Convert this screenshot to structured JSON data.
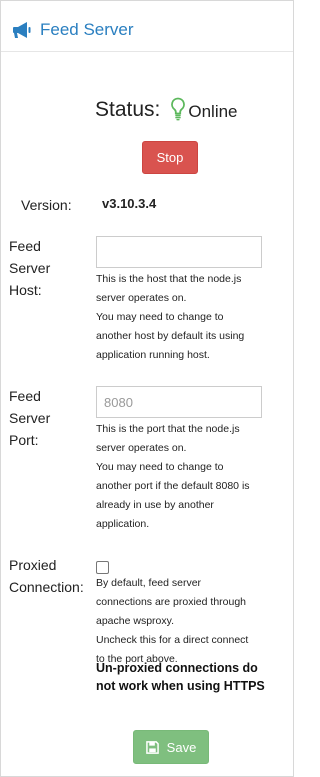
{
  "header": {
    "title": "Feed Server",
    "icon": "megaphone-icon",
    "accent_color": "#2a7fc0"
  },
  "status": {
    "label": "Status:",
    "value": "Online",
    "icon": "lightbulb-icon",
    "icon_color": "#5cb85c"
  },
  "stop_button": {
    "label": "Stop",
    "color": "#d9534f"
  },
  "version": {
    "label": "Version:",
    "value": "v3.10.3.4"
  },
  "host": {
    "label_lines": [
      "Feed",
      "Server",
      "Host:"
    ],
    "value": "",
    "placeholder": "",
    "help_lines": [
      "This is the host that the node.js",
      "server operates on.",
      "You may need to change to",
      "another host by default its using",
      "application running host."
    ]
  },
  "port": {
    "label_lines": [
      "Feed",
      "Server",
      "Port:"
    ],
    "value": "",
    "placeholder": "8080",
    "help_lines": [
      "This is the port that the node.js",
      "server operates on.",
      "You may need to change to",
      "another port if the default 8080 is",
      "already in use by another",
      "application."
    ]
  },
  "proxied": {
    "label_lines": [
      "Proxied",
      "Connection:"
    ],
    "checked": false,
    "help_lines": [
      "By default, feed server",
      "connections are proxied through",
      "apache wsproxy.",
      "Uncheck this for a direct connect",
      "to the port above."
    ],
    "warning_lines": [
      "Un-proxied connections do",
      "not work when using HTTPS"
    ]
  },
  "save_button": {
    "label": "Save",
    "icon": "floppy-disk-icon",
    "color": "#7fbf7f"
  }
}
